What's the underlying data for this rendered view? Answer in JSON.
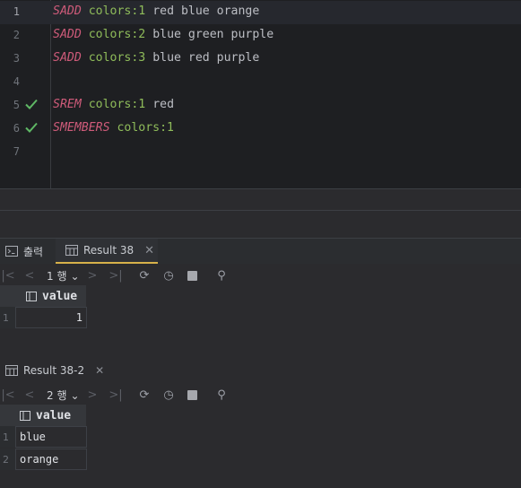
{
  "editor": {
    "lines": [
      {
        "num": "1",
        "cmd": "SADD",
        "key": "colors:1",
        "args": " red blue orange",
        "check": false
      },
      {
        "num": "2",
        "cmd": "SADD",
        "key": "colors:2",
        "args": " blue green purple",
        "check": false
      },
      {
        "num": "3",
        "cmd": "SADD",
        "key": "colors:3",
        "args": " blue red purple",
        "check": false
      },
      {
        "num": "4",
        "cmd": "",
        "key": "",
        "args": "",
        "check": false
      },
      {
        "num": "5",
        "cmd": "SREM",
        "key": "colors:1",
        "args": " red",
        "check": true
      },
      {
        "num": "6",
        "cmd": "SMEMBERS",
        "key": "colors:1",
        "args": "",
        "check": true
      },
      {
        "num": "7",
        "cmd": "",
        "key": "",
        "args": "",
        "check": false
      }
    ]
  },
  "panel": {
    "tabs": [
      {
        "label": "출력",
        "icon": "console-icon"
      },
      {
        "label": "Result 38",
        "icon": "table-icon"
      }
    ]
  },
  "result1": {
    "page_label": "1 행",
    "column": "value",
    "rows": [
      {
        "n": "1",
        "v": "1"
      }
    ]
  },
  "result2": {
    "title": "Result 38-2",
    "page_label": "2 행",
    "column": "value",
    "rows": [
      {
        "n": "1",
        "v": "blue"
      },
      {
        "n": "2",
        "v": "orange"
      }
    ]
  },
  "colors": {
    "accent": "#d7b14a",
    "check": "#5fb865",
    "keyword": "#cf5b7a",
    "key": "#8fbc5a"
  }
}
